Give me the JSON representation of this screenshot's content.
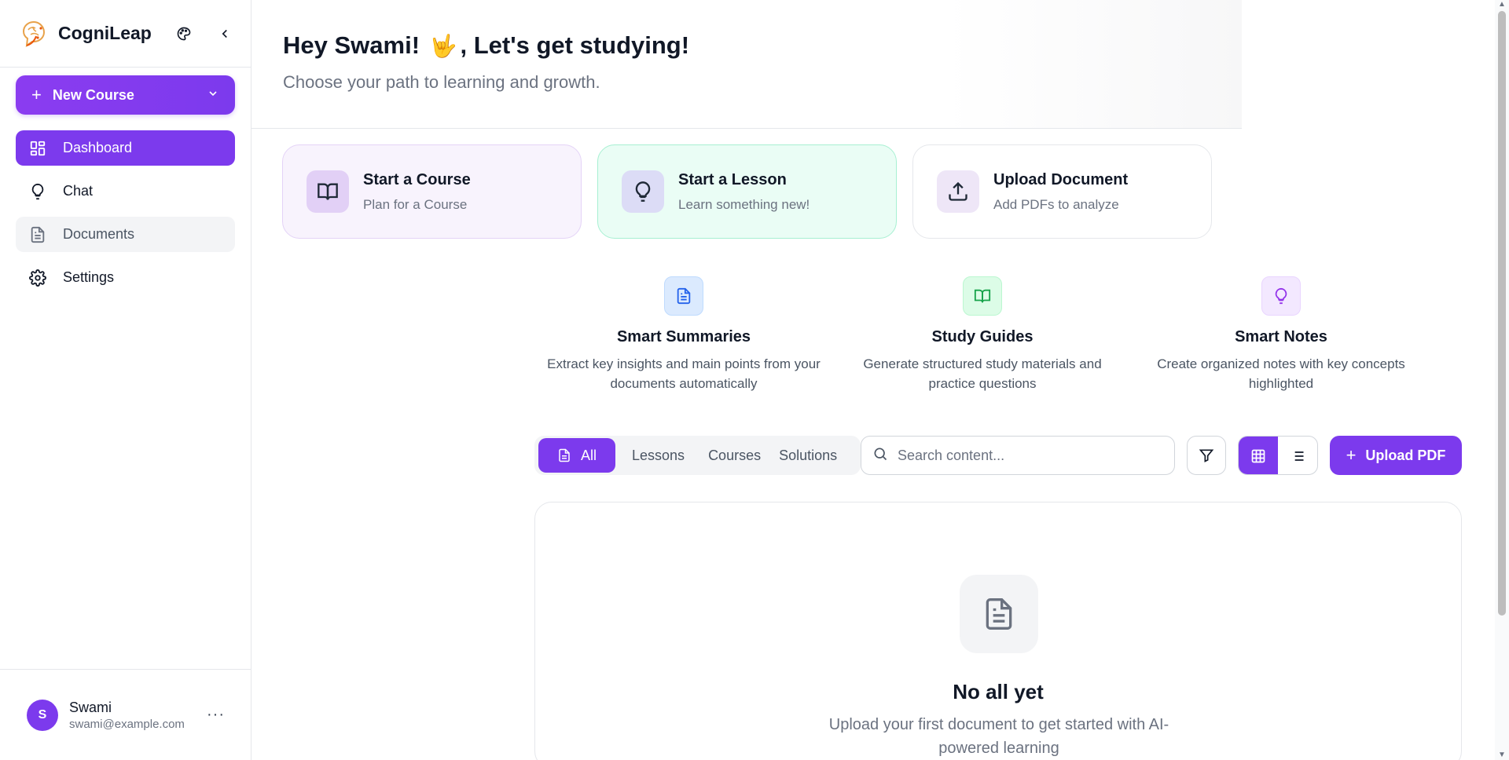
{
  "sidebar": {
    "brand": "CogniLeap",
    "new_course_label": "New Course",
    "nav": [
      {
        "label": "Dashboard",
        "icon": "dashboard-icon"
      },
      {
        "label": "Chat",
        "icon": "lightbulb-icon"
      },
      {
        "label": "Documents",
        "icon": "document-icon"
      },
      {
        "label": "Settings",
        "icon": "gear-icon"
      }
    ],
    "user": {
      "initial": "S",
      "name": "Swami",
      "email": "swami@example.com",
      "more": "···"
    }
  },
  "hero": {
    "greeting_start": "Hey Swami!",
    "greeting_emoji": "🤟",
    "greeting_end": ", Let's get studying!",
    "subtitle": "Choose your path to learning and growth."
  },
  "cards": [
    {
      "title": "Start a Course",
      "subtitle": "Plan for a Course",
      "icon": "book-open-icon"
    },
    {
      "title": "Start a Lesson",
      "subtitle": "Learn something new!",
      "icon": "lightbulb-icon"
    },
    {
      "title": "Upload Document",
      "subtitle": "Add PDFs to analyze",
      "icon": "upload-icon"
    }
  ],
  "features": [
    {
      "title": "Smart Summaries",
      "desc": "Extract key insights and main points from your documents automatically",
      "icon": "document-icon",
      "color": "#2563eb"
    },
    {
      "title": "Study Guides",
      "desc": "Generate structured study materials and practice questions",
      "icon": "book-open-icon",
      "color": "#16a34a"
    },
    {
      "title": "Smart Notes",
      "desc": "Create organized notes with key concepts highlighted",
      "icon": "lightbulb-icon",
      "color": "#9333ea"
    }
  ],
  "toolbar": {
    "tabs": [
      "All",
      "Lessons",
      "Courses",
      "Solutions"
    ],
    "search_placeholder": "Search content...",
    "upload_label": "Upload PDF"
  },
  "empty": {
    "title": "No all yet",
    "desc": "Upload your first document to get started with AI-powered learning"
  },
  "colors": {
    "accent": "#7c3aed"
  }
}
